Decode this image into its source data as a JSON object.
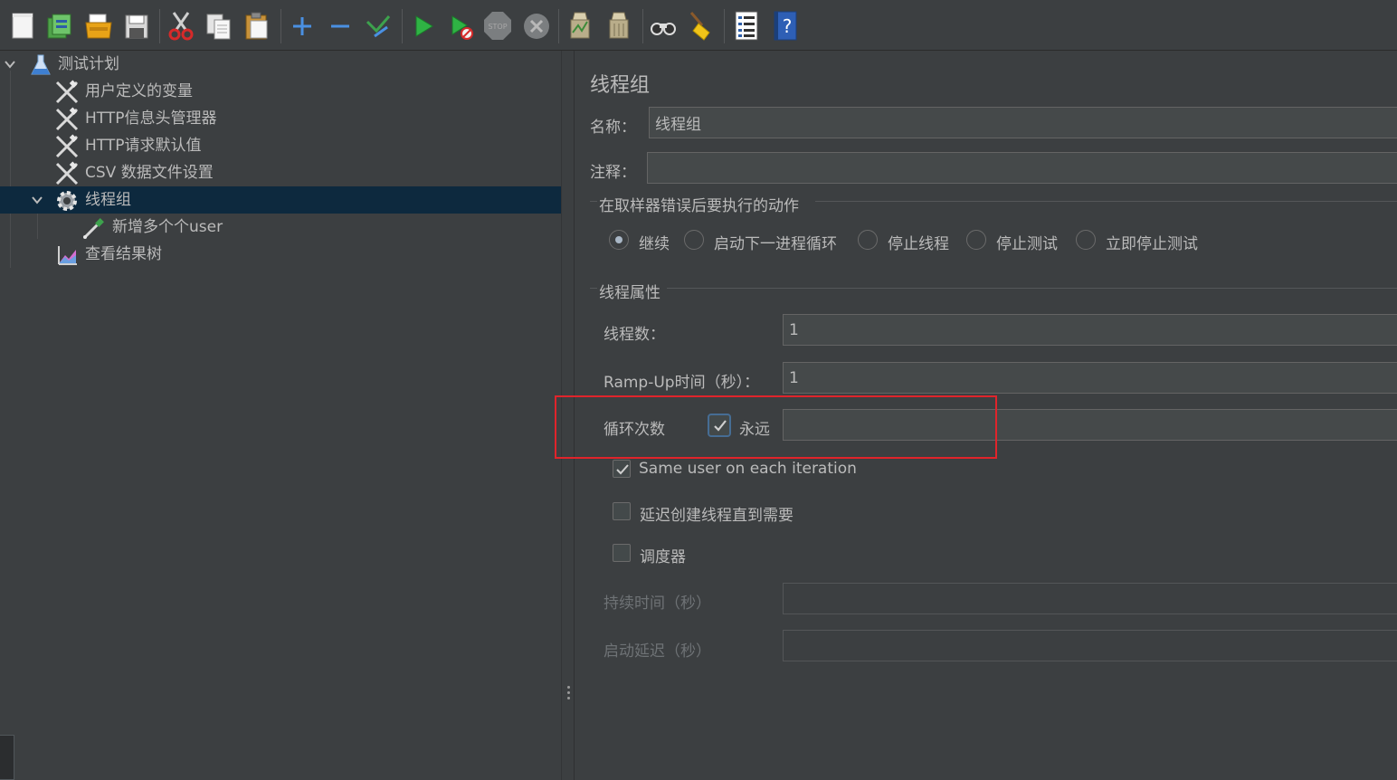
{
  "toolbar": {
    "buttons": [
      {
        "icon": "new-icon"
      },
      {
        "icon": "templates-icon"
      },
      {
        "icon": "open-icon"
      },
      {
        "icon": "save-icon"
      },
      {
        "icon": "cut-icon"
      },
      {
        "icon": "copy-icon"
      },
      {
        "icon": "paste-icon"
      },
      {
        "icon": "expand-icon"
      },
      {
        "icon": "collapse-icon"
      },
      {
        "icon": "toggle-icon"
      },
      {
        "icon": "start-icon"
      },
      {
        "icon": "start-no-pause-icon"
      },
      {
        "icon": "stop-icon",
        "label": "STOP"
      },
      {
        "icon": "shutdown-icon"
      },
      {
        "icon": "clear-icon"
      },
      {
        "icon": "clear-all-icon"
      },
      {
        "icon": "search-icon"
      },
      {
        "icon": "reset-search-icon"
      },
      {
        "icon": "function-helper-icon"
      },
      {
        "icon": "help-icon",
        "label": "?"
      }
    ]
  },
  "tree": {
    "items": [
      {
        "label": "测试计划",
        "icon": "test-plan-icon"
      },
      {
        "label": "用户定义的变量",
        "icon": "config-element-icon"
      },
      {
        "label": "HTTP信息头管理器",
        "icon": "config-element-icon"
      },
      {
        "label": "HTTP请求默认值",
        "icon": "config-element-icon"
      },
      {
        "label": "CSV 数据文件设置",
        "icon": "config-element-icon"
      },
      {
        "label": "线程组",
        "icon": "thread-group-gear-icon"
      },
      {
        "label": "新增多个个user",
        "icon": "sampler-pipette-icon"
      },
      {
        "label": "查看结果树",
        "icon": "listener-graph-icon"
      }
    ]
  },
  "panel": {
    "title": "线程组",
    "name_label": "名称：",
    "name_value": "线程组",
    "comment_label": "注释：",
    "comment_value": "",
    "error_action": {
      "title": "在取样器错误后要执行的动作",
      "options": [
        "继续",
        "启动下一进程循环",
        "停止线程",
        "停止测试",
        "立即停止测试"
      ],
      "selected": "继续"
    },
    "thread_props": {
      "title": "线程属性",
      "threads_label": "线程数：",
      "threads_value": "1",
      "rampup_label": "Ramp-Up时间（秒）：",
      "rampup_value": "1",
      "loop_label": "循环次数",
      "forever_label": "永远",
      "forever_checked": true,
      "loop_value": "",
      "same_user_label": "Same user on each iteration",
      "same_user_checked": true,
      "delay_label": "延迟创建线程直到需要",
      "delay_checked": false,
      "scheduler_label": "调度器",
      "scheduler_checked": false,
      "duration_label": "持续时间（秒）",
      "duration_value": "",
      "startup_delay_label": "启动延迟（秒）",
      "startup_delay_value": ""
    }
  },
  "colors": {
    "background": "#3c3f41",
    "selection": "#0d293e",
    "text": "#bbbbbb",
    "disabled_text": "#6e7275",
    "highlight_border": "#e0242b",
    "input_bg": "#45494a"
  }
}
